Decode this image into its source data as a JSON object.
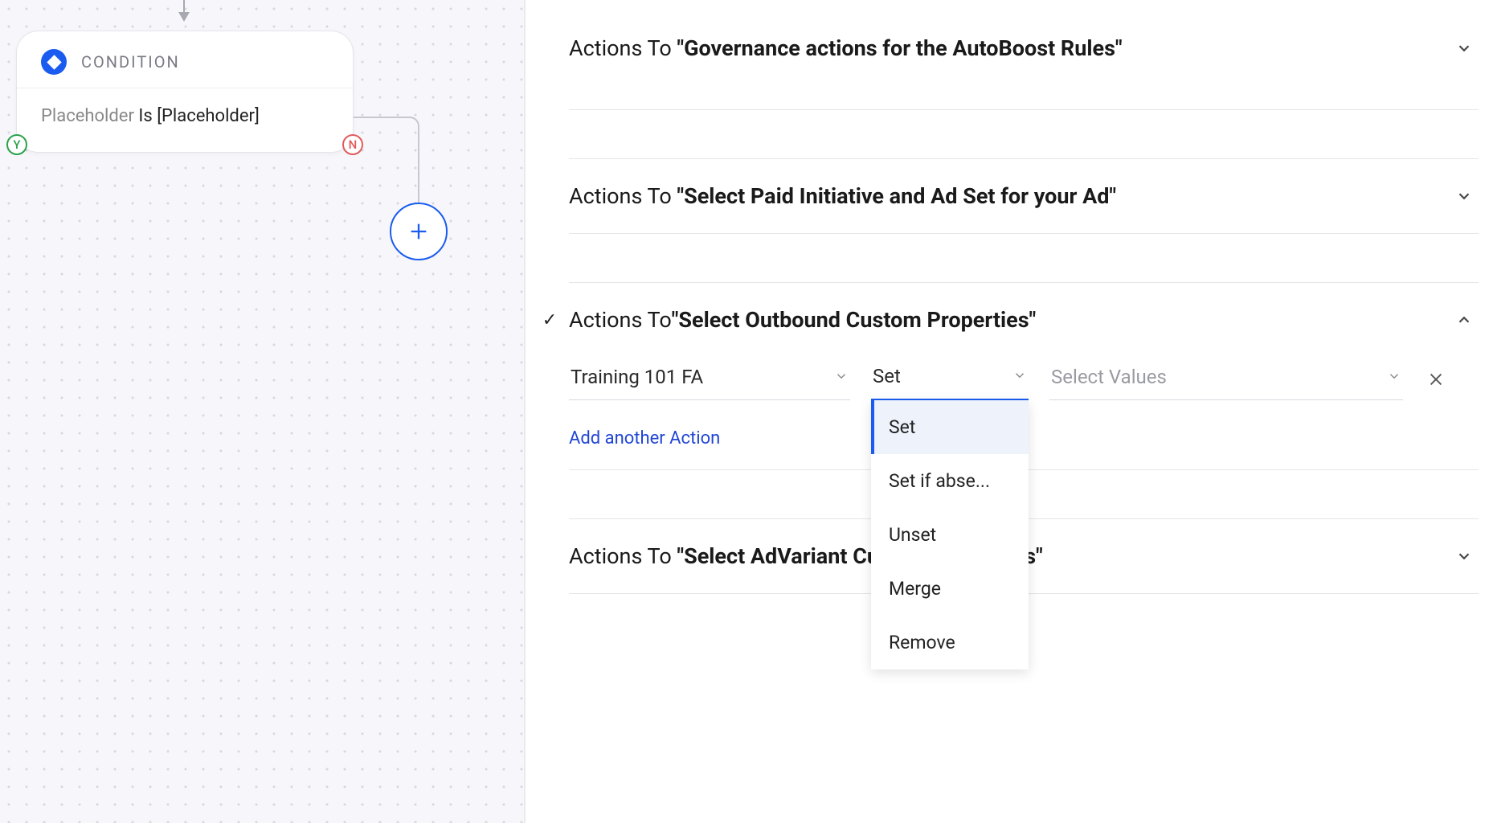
{
  "canvas": {
    "condition": {
      "title": "CONDITION",
      "placeholder_label": "Placeholder",
      "operator": "Is",
      "value": "[Placeholder]",
      "yes_badge": "Y",
      "no_badge": "N"
    }
  },
  "panel": {
    "sections": [
      {
        "prefix": "Actions To ",
        "title": "\"Governance actions for the AutoBoost Rules\"",
        "expanded": false,
        "checked": false
      },
      {
        "prefix": "Actions To ",
        "title": "\"Select Paid Initiative and Ad Set for your Ad\"",
        "expanded": false,
        "checked": false
      },
      {
        "prefix": "Actions To ",
        "title": "\"Select Outbound Custom Properties\"",
        "expanded": true,
        "checked": true
      },
      {
        "prefix": "Actions To ",
        "title": "\"Select AdVariant Custom Properties\"",
        "expanded": false,
        "checked": false,
        "truncated_title": "\"Select AdVariant                      ties\""
      }
    ],
    "action_row": {
      "field": "Training 101 FA",
      "operator": "Set",
      "values_placeholder": "Select Values"
    },
    "operator_options": [
      "Set",
      "Set if abse...",
      "Unset",
      "Merge",
      "Remove"
    ],
    "add_action_label": "Add another Action"
  }
}
